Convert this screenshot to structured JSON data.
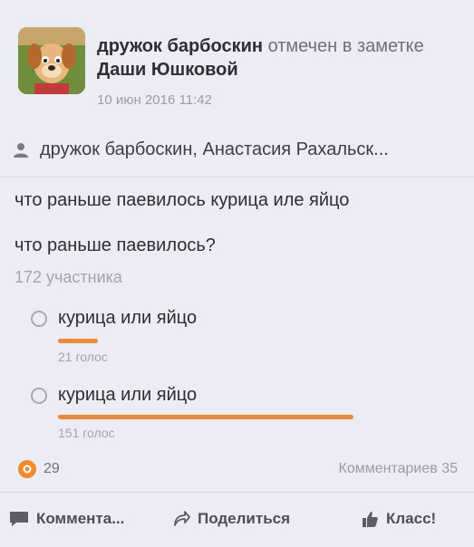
{
  "post": {
    "author": "дружок барбоскин",
    "action_text": "отмечен в заметке",
    "tagged_by": "Даши Юшковой",
    "timestamp": "10 июн 2016 11:42",
    "participants": "дружок барбоскин, Анастасия Рахальск..."
  },
  "poll": {
    "title": "что раньше паевилось курица иле яйцо",
    "question": "что раньше паевилось?",
    "total": "172 участника",
    "options": [
      {
        "label": "курица или яйцо",
        "votes": "21 голос",
        "share": 0.12
      },
      {
        "label": "курица или яйцо",
        "votes": "151 голос",
        "share": 0.88
      }
    ]
  },
  "footer": {
    "likes": "29",
    "comments": "Комментариев 35",
    "actions": {
      "comment": "Коммента...",
      "share": "Поделиться",
      "like": "Класс!"
    }
  },
  "colors": {
    "accent": "#e8893b",
    "background": "#ecedf4"
  }
}
